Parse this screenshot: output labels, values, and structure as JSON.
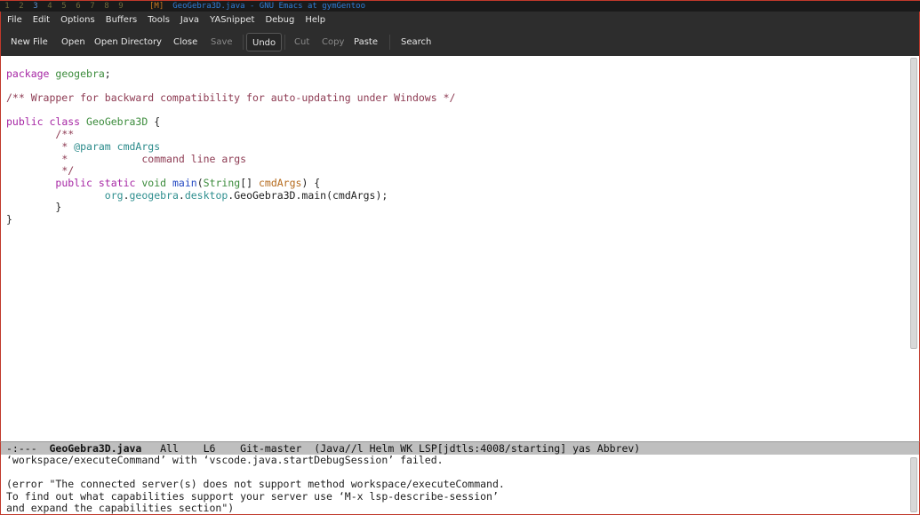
{
  "workspaces": [
    "1",
    "2",
    "3",
    "4",
    "5",
    "6",
    "7",
    "8",
    "9"
  ],
  "active_workspace": "3",
  "window_flag": "[M]",
  "window_title": "GeoGebra3D.java - GNU Emacs at gymGentoo",
  "menu": [
    "File",
    "Edit",
    "Options",
    "Buffers",
    "Tools",
    "Java",
    "YASnippet",
    "Debug",
    "Help"
  ],
  "toolbar": {
    "new_file": "New File",
    "open": "Open",
    "open_directory": "Open Directory",
    "close": "Close",
    "save": "Save",
    "undo": "Undo",
    "cut": "Cut",
    "copy": "Copy",
    "paste": "Paste",
    "search": "Search"
  },
  "code": {
    "l1_kw": "package",
    "l1_pkg": "geogebra",
    "l1_end": ";",
    "l3_comment": "/** Wrapper for backward compatibility for auto-updating under Windows */",
    "l5_kw1": "public",
    "l5_kw2": "class",
    "l5_name": "GeoGebra3D",
    "l5_brace": "{",
    "l6_open": "/**",
    "l7_star": "* ",
    "l7_tag": "@param",
    "l7_param": "cmdArgs",
    "l8_star": "*",
    "l8_text": "command line args",
    "l9_close": "*/",
    "l10_kw1": "public",
    "l10_kw2": "static",
    "l10_void": "void",
    "l10_fn": "main",
    "l10_type": "String",
    "l10_arr": "[] ",
    "l10_param": "cmdArgs",
    "l10_end": ") {",
    "l11_pk1": "org",
    "l11_pk2": "geogebra",
    "l11_pk3": "desktop",
    "l11_rest": "GeoGebra3D.main(cmdArgs);",
    "l12_brace": "}",
    "l13_brace": "}"
  },
  "modeline": {
    "status": "-:---",
    "buffer": "GeoGebra3D.java",
    "position": "All",
    "line": "L6",
    "vc": "Git-master",
    "modes": "(Java//l Helm WK LSP[jdtls:4008/starting] yas Abbrev)"
  },
  "echo": [
    "‘workspace/executeCommand’ with ‘vscode.java.startDebugSession’ failed.",
    "",
    "(error \"The connected server(s) does not support method workspace/executeCommand.",
    "To find out what capabilities support your server use ‘M-x lsp-describe-session’",
    "and expand the capabilities section\")"
  ],
  "colors": {
    "keyword": "#a626a4",
    "comment": "#8d3a52",
    "type": "#3b8b3b",
    "function": "#2449c2",
    "frame_border": "#c0392b"
  }
}
